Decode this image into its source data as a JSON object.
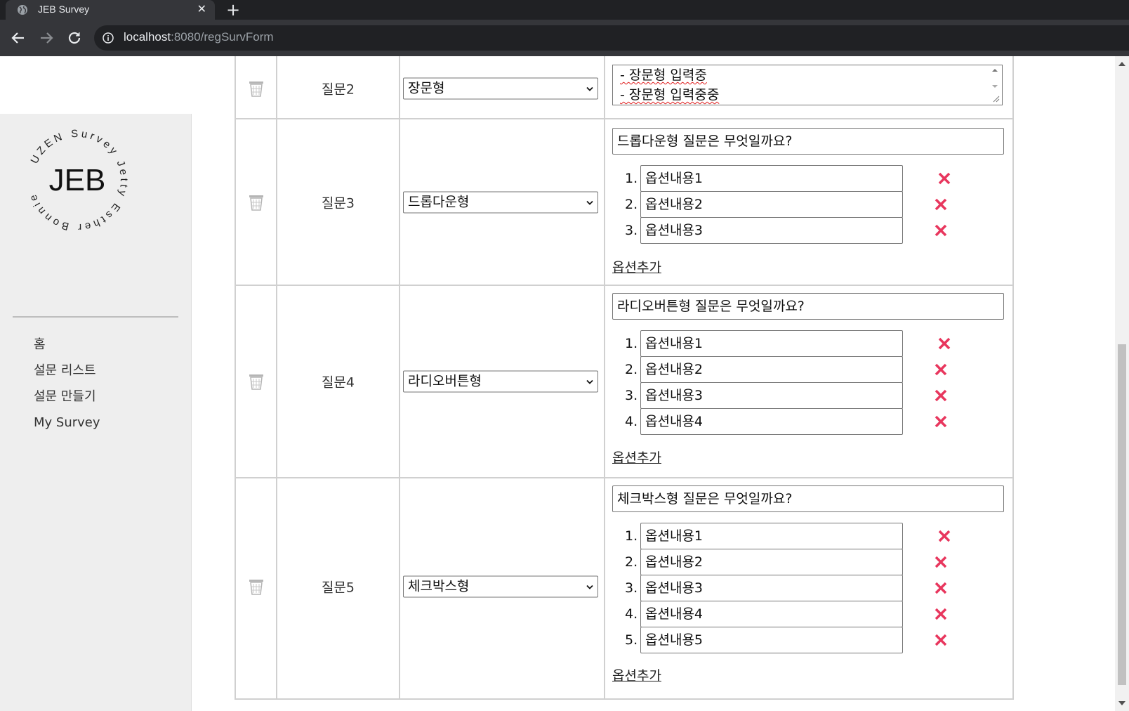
{
  "browser": {
    "tab_title": "JEB Survey",
    "url_host": "localhost",
    "url_path": ":8080/regSurvForm"
  },
  "sidebar": {
    "logo": {
      "center": "JEB",
      "ring": "UZEN Survey Jetty Esther Bonnie"
    },
    "items": [
      {
        "label": "홈"
      },
      {
        "label": "설문 리스트"
      },
      {
        "label": "설문 만들기"
      },
      {
        "label": "My Survey"
      }
    ]
  },
  "questions": [
    {
      "label": "질문2",
      "type": "장문형",
      "answer_lines": [
        "- 장문형 입력중",
        "- 장문형 입력중중"
      ]
    },
    {
      "label": "질문3",
      "type": "드롭다운형",
      "question": "드롭다운형 질문은 무엇일까요?",
      "options": [
        {
          "num": "1.",
          "value": "옵션내용1"
        },
        {
          "num": "2.",
          "value": "옵션내용2"
        },
        {
          "num": "3.",
          "value": "옵션내용3"
        }
      ],
      "add_label": "옵션추가"
    },
    {
      "label": "질문4",
      "type": "라디오버튼형",
      "question": "라디오버튼형 질문은 무엇일까요?",
      "options": [
        {
          "num": "1.",
          "value": "옵션내용1"
        },
        {
          "num": "2.",
          "value": "옵션내용2"
        },
        {
          "num": "3.",
          "value": "옵션내용3"
        },
        {
          "num": "4.",
          "value": "옵션내용4"
        }
      ],
      "add_label": "옵션추가"
    },
    {
      "label": "질문5",
      "type": "체크박스형",
      "question": "체크박스형 질문은 무엇일까요?",
      "options": [
        {
          "num": "1.",
          "value": "옵션내용1"
        },
        {
          "num": "2.",
          "value": "옵션내용2"
        },
        {
          "num": "3.",
          "value": "옵션내용3"
        },
        {
          "num": "4.",
          "value": "옵션내용4"
        },
        {
          "num": "5.",
          "value": "옵션내용5"
        }
      ],
      "add_label": "옵션추가"
    }
  ],
  "colors": {
    "delete_x": "#e8365d",
    "border": "#d0d0d0",
    "sidebar_bg": "#eeeeee",
    "chrome_dark": "#202124",
    "chrome_bar": "#35363a"
  }
}
